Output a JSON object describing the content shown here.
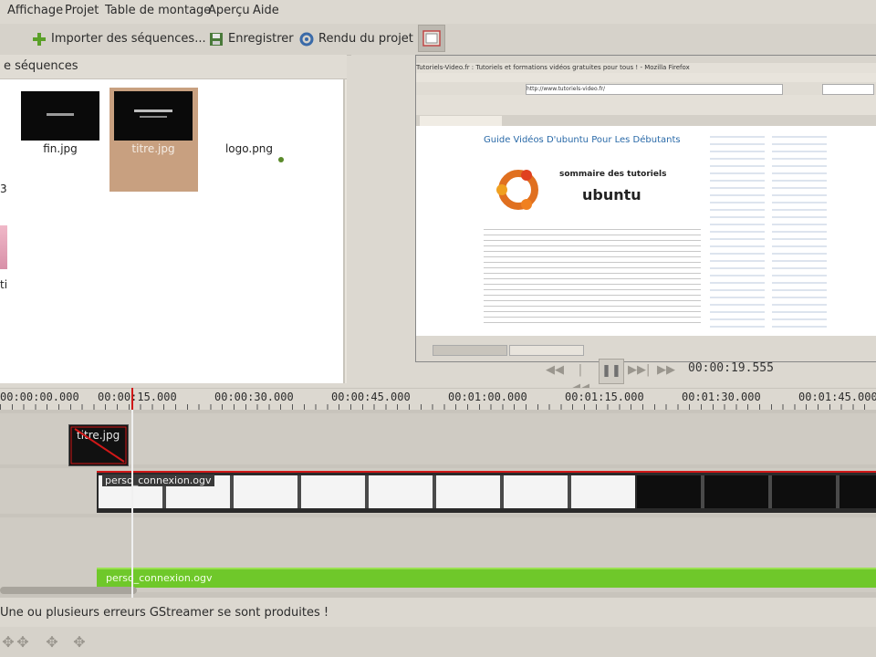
{
  "menubar": {
    "items": [
      "Affichage",
      "Projet",
      "Table de montage",
      "Aperçu",
      "Aide"
    ]
  },
  "toolbar": {
    "import_label": "Importer des séquences...",
    "save_label": "Enregistrer",
    "render_label": "Rendu du projet"
  },
  "library": {
    "title": "e séquences",
    "items": [
      {
        "name": "fin.jpg"
      },
      {
        "name": "titre.jpg"
      },
      {
        "name": "logo.png"
      }
    ],
    "partial_left_1": "3",
    "partial_left_2": "ti"
  },
  "viewer": {
    "browser_title": "Tutoriels-Video.fr : Tutoriels et formations vidéos gratuites pour tous ! - Mozilla Firefox",
    "url": "http://www.tutoriels-video.fr/",
    "article_title": "Guide Vidéos D'ubuntu Pour Les Débutants",
    "logo_line1": "sommaire des tutoriels",
    "logo_line2": "ubuntu",
    "timecode": "00:00:19.555"
  },
  "ruler": {
    "ticks": [
      "00:00:00.000",
      "00:00:15.000",
      "00:00:30.000",
      "00:00:45.000",
      "00:01:00.000",
      "00:01:15.000",
      "00:01:30.000",
      "00:01:45.000"
    ]
  },
  "timeline": {
    "title_clip": "titre.jpg",
    "video_clip": "perso_connexion.ogv",
    "audio_clip": "perso_connexion.ogv"
  },
  "status": {
    "message": "Une ou plusieurs erreurs GStreamer se sont produites !"
  },
  "colors": {
    "audio_green": "#6fc82a",
    "playhead_red": "#d01818",
    "selected_thumb_bg": "#c8a080"
  }
}
